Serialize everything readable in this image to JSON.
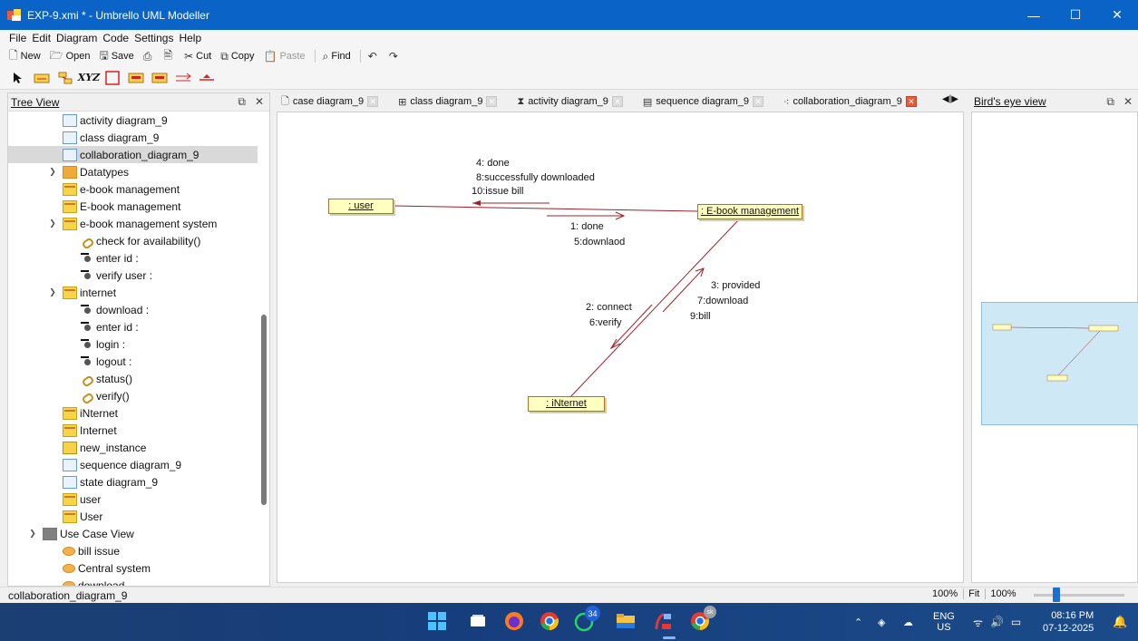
{
  "window": {
    "title": "EXP-9.xmi * - Umbrello UML Modeller",
    "controls": {
      "minimize": "—",
      "maximize": "☐",
      "close": "✕"
    }
  },
  "menu": [
    "File",
    "Edit",
    "Diagram",
    "Code",
    "Settings",
    "Help"
  ],
  "toolbar": {
    "new": "New",
    "open": "Open",
    "save": "Save",
    "cut": "Cut",
    "copy": "Copy",
    "paste": "Paste",
    "find": "Find"
  },
  "tree_view": {
    "title": "Tree View",
    "items": [
      {
        "label": "activity diagram_9",
        "icon": "diagram-icon"
      },
      {
        "label": "class diagram_9",
        "icon": "diagram-icon"
      },
      {
        "label": "collaboration_diagram_9",
        "icon": "diagram-icon"
      },
      {
        "label": "Datatypes",
        "icon": "folder-icon"
      },
      {
        "label": "e-book management",
        "icon": "class-icon"
      },
      {
        "label": "E-book management",
        "icon": "class-icon"
      },
      {
        "label": "e-book management system",
        "icon": "class-icon"
      },
      {
        "label": "check for availability()",
        "icon": "method-icon"
      },
      {
        "label": "enter id :",
        "icon": "attribute-icon"
      },
      {
        "label": "verify user :",
        "icon": "attribute-icon"
      },
      {
        "label": "internet",
        "icon": "class-icon"
      },
      {
        "label": "download :",
        "icon": "attribute-icon"
      },
      {
        "label": "enter id :",
        "icon": "attribute-icon"
      },
      {
        "label": "login :",
        "icon": "attribute-icon"
      },
      {
        "label": "logout :",
        "icon": "attribute-icon"
      },
      {
        "label": "status()",
        "icon": "method-icon"
      },
      {
        "label": "verify()",
        "icon": "method-icon"
      },
      {
        "label": "iNternet",
        "icon": "class-icon"
      },
      {
        "label": "Internet",
        "icon": "class-icon"
      },
      {
        "label": "new_instance",
        "icon": "object-icon"
      },
      {
        "label": "sequence diagram_9",
        "icon": "diagram-icon"
      },
      {
        "label": "state diagram_9",
        "icon": "diagram-icon"
      },
      {
        "label": "user",
        "icon": "class-icon"
      },
      {
        "label": "User",
        "icon": "class-icon"
      },
      {
        "label": "Use Case View",
        "icon": "folder-icon"
      },
      {
        "label": "bill issue",
        "icon": "usecase-icon"
      },
      {
        "label": "Central system",
        "icon": "usecase-icon"
      },
      {
        "label": "download",
        "icon": "usecase-icon"
      }
    ]
  },
  "tabs": [
    {
      "label": "case diagram_9",
      "icon": "usecase-diagram-icon"
    },
    {
      "label": "class diagram_9",
      "icon": "class-diagram-icon"
    },
    {
      "label": "activity diagram_9",
      "icon": "activity-diagram-icon"
    },
    {
      "label": "sequence diagram_9",
      "icon": "sequence-diagram-icon"
    },
    {
      "label": "collaboration_diagram_9",
      "icon": "collaboration-diagram-icon",
      "active": true
    }
  ],
  "diagram": {
    "objects": {
      "user": ": user",
      "ebook": ": E-book management",
      "internet": ": iNternet"
    },
    "messages": {
      "m_top": [
        "4: done",
        "8:successfully downloaded",
        "10:issue bill"
      ],
      "m_mid": [
        "1: done",
        "5:downlaod"
      ],
      "m_right": [
        "3: provided",
        "7:download",
        "9:bill"
      ],
      "m_left": [
        "2: connect",
        "6:verify"
      ]
    },
    "colors": {
      "object_fill": "#ffffc0",
      "object_border": "#b07030",
      "link": "#a0202a"
    }
  },
  "birds_eye": {
    "title": "Bird's eye view"
  },
  "status": {
    "text": "collaboration_diagram_9",
    "zoom": "100%",
    "fit": "Fit",
    "zoom2": "100%",
    "zoom_slider_level": 0.25
  },
  "taskbar": {
    "badge_whatsapp": "34",
    "badge_chrome": "sk",
    "lang": "ENG",
    "region": "US",
    "time": "08:16 PM",
    "date": "07-12-2025"
  }
}
